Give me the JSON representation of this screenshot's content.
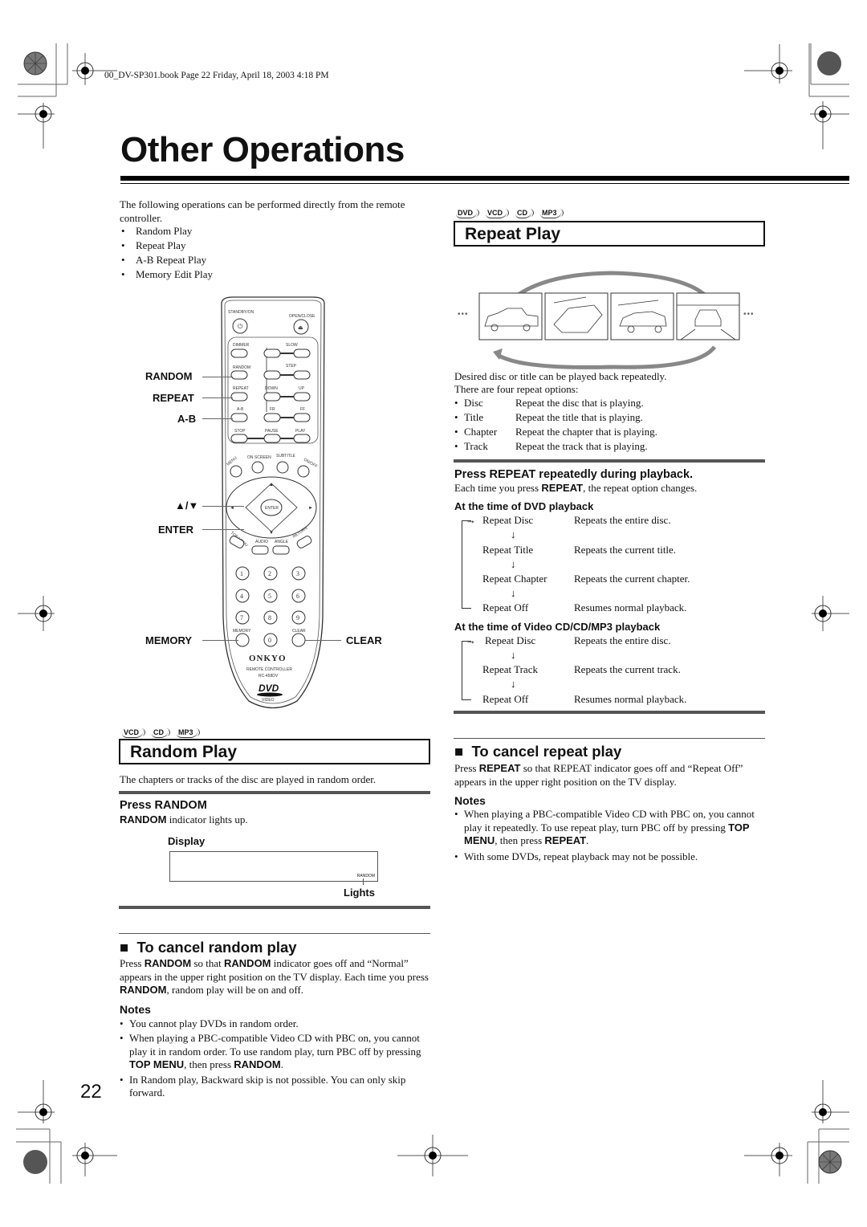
{
  "header": {
    "book_info": "00_DV-SP301.book  Page 22  Friday, April 18, 2003  4:18 PM"
  },
  "page": {
    "title": "Other Operations",
    "number": "22"
  },
  "intro": {
    "text": "The following operations can be performed directly from the remote controller.",
    "items": [
      "Random Play",
      "Repeat Play",
      "A-B Repeat Play",
      "Memory Edit Play"
    ]
  },
  "remote": {
    "callouts_left": [
      "RANDOM",
      "REPEAT",
      "A-B",
      "▲/▼",
      "ENTER",
      "MEMORY"
    ],
    "callouts_right": [
      "CLEAR"
    ],
    "labels": {
      "standby": "STANDBY/ON",
      "open_close": "OPEN/CLOSE",
      "dimmer": "DIMMER",
      "slow": "SLOW",
      "random": "RANDOM",
      "step": "STEP",
      "repeat": "REPEAT",
      "down": "DOWN",
      "up": "UP",
      "ab": "A-B",
      "fr": "FR",
      "ff": "FF",
      "stop": "STOP",
      "pause": "PAUSE",
      "play": "PLAY",
      "menu": "MENU",
      "on_screen": "ON SCREEN",
      "subtitle": "SUBTITLE",
      "on_off": "ON/OFF",
      "enter": "ENTER",
      "top_menu": "TOP MENU",
      "audio": "AUDIO",
      "angle": "ANGLE",
      "return": "RETURN",
      "memory": "MEMORY",
      "clear": "CLEAR",
      "brand": "ONKYO",
      "remote_controller": "REMOTE CONTROLLER",
      "model": "RC-458DV",
      "dvd_logo": "DVD",
      "video": "VIDEO"
    },
    "digits": [
      "1",
      "2",
      "3",
      "4",
      "5",
      "6",
      "7",
      "8",
      "9",
      "0"
    ]
  },
  "random_play": {
    "badges": [
      "VCD",
      "CD",
      "MP3"
    ],
    "title": "Random Play",
    "description": "The chapters or tracks of the disc are played in random order.",
    "step_title": "Press RANDOM",
    "step_key": "RANDOM",
    "step_text": " indicator lights up.",
    "display_label": "Display",
    "display_indicator": "RANDOM",
    "lights_label": "Lights",
    "cancel": {
      "title": "To cancel random play",
      "p1_a": "Press ",
      "p1_k1": "RANDOM",
      "p1_b": " so that ",
      "p1_k2": "RANDOM",
      "p1_c": " indicator goes off and “Normal” appears in the upper right position on the TV display. Each time you press ",
      "p1_k3": "RANDOM",
      "p1_d": ", random play will be on and off.",
      "notes_title": "Notes",
      "note1": "You cannot play DVDs in random order.",
      "note2_a": "When playing a PBC-compatible Video CD with PBC on, you cannot play it in random order. To use random play, turn PBC off by pressing ",
      "note2_k1": "TOP MENU",
      "note2_b": ", then press ",
      "note2_k2": "RANDOM",
      "note2_c": ".",
      "note3": "In Random play, Backward skip is not possible. You can only skip forward."
    }
  },
  "repeat_play": {
    "badges": [
      "DVD",
      "VCD",
      "CD",
      "MP3"
    ],
    "title": "Repeat Play",
    "description_1": "Desired disc or title can be played back repeatedly.",
    "description_2": "There are four repeat options:",
    "options": [
      {
        "name": "Disc",
        "desc": "Repeat the disc that is playing."
      },
      {
        "name": "Title",
        "desc": "Repeat the title that is playing."
      },
      {
        "name": "Chapter",
        "desc": "Repeat the chapter that is playing."
      },
      {
        "name": "Track",
        "desc": "Repeat the track that is playing."
      }
    ],
    "step_title": "Press REPEAT repeatedly during playback.",
    "step_a": "Each time you press ",
    "step_k": "REPEAT",
    "step_b": ", the repeat option changes.",
    "dvd_heading": "At the time of DVD playback",
    "dvd_sequence": [
      {
        "mode": "Repeat Disc",
        "desc": "Repeats the entire disc."
      },
      {
        "mode": "Repeat Title",
        "desc": "Repeats the current title."
      },
      {
        "mode": "Repeat Chapter",
        "desc": "Repeats the current chapter."
      },
      {
        "mode": "Repeat Off",
        "desc": "Resumes normal playback."
      }
    ],
    "vcd_heading": "At the time of Video CD/CD/MP3 playback",
    "vcd_sequence": [
      {
        "mode": "Repeat Disc",
        "desc": "Repeats the entire disc."
      },
      {
        "mode": "Repeat Track",
        "desc": "Repeats the current track."
      },
      {
        "mode": "Repeat Off",
        "desc": "Resumes normal playback."
      }
    ],
    "cancel": {
      "title": "To cancel repeat play",
      "p1_a": "Press ",
      "p1_k": "REPEAT",
      "p1_b": " so that REPEAT indicator goes off and “Repeat Off” appears in the upper right position on the TV display.",
      "notes_title": "Notes",
      "note1_a": "When playing a PBC-compatible Video CD with PBC on, you cannot play it repeatedly. To use repeat play, turn PBC off by pressing ",
      "note1_k1": "TOP MENU",
      "note1_b": ", then press ",
      "note1_k2": "REPEAT",
      "note1_c": ".",
      "note2": "With some DVDs, repeat playback may not be possible."
    }
  },
  "symbols": {
    "ellipsis": "•••",
    "down_arrow": "↓",
    "right_arrow": "→",
    "square": "■"
  }
}
